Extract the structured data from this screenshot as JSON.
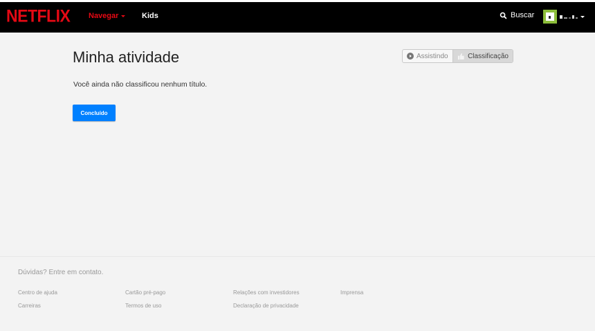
{
  "header": {
    "logo": "NETFLIX",
    "nav_browse": "Navegar",
    "nav_kids": "Kids",
    "search_label": "Buscar"
  },
  "main": {
    "title": "Minha atividade",
    "toggle": {
      "watching": "Assistindo",
      "ratings": "Classificação"
    },
    "message": "Você ainda não classificou nenhum título.",
    "done_button": "Concluído"
  },
  "footer": {
    "contact": "Dúvidas? Entre em contato.",
    "links": [
      "Centro de ajuda",
      "Cartão pré-pago",
      "Relações com investidores",
      "Imprensa",
      "Carreiras",
      "Termos de uso",
      "Declaração de privacidade"
    ]
  },
  "colors": {
    "brand": "#e50914",
    "button": "#0080ff"
  }
}
